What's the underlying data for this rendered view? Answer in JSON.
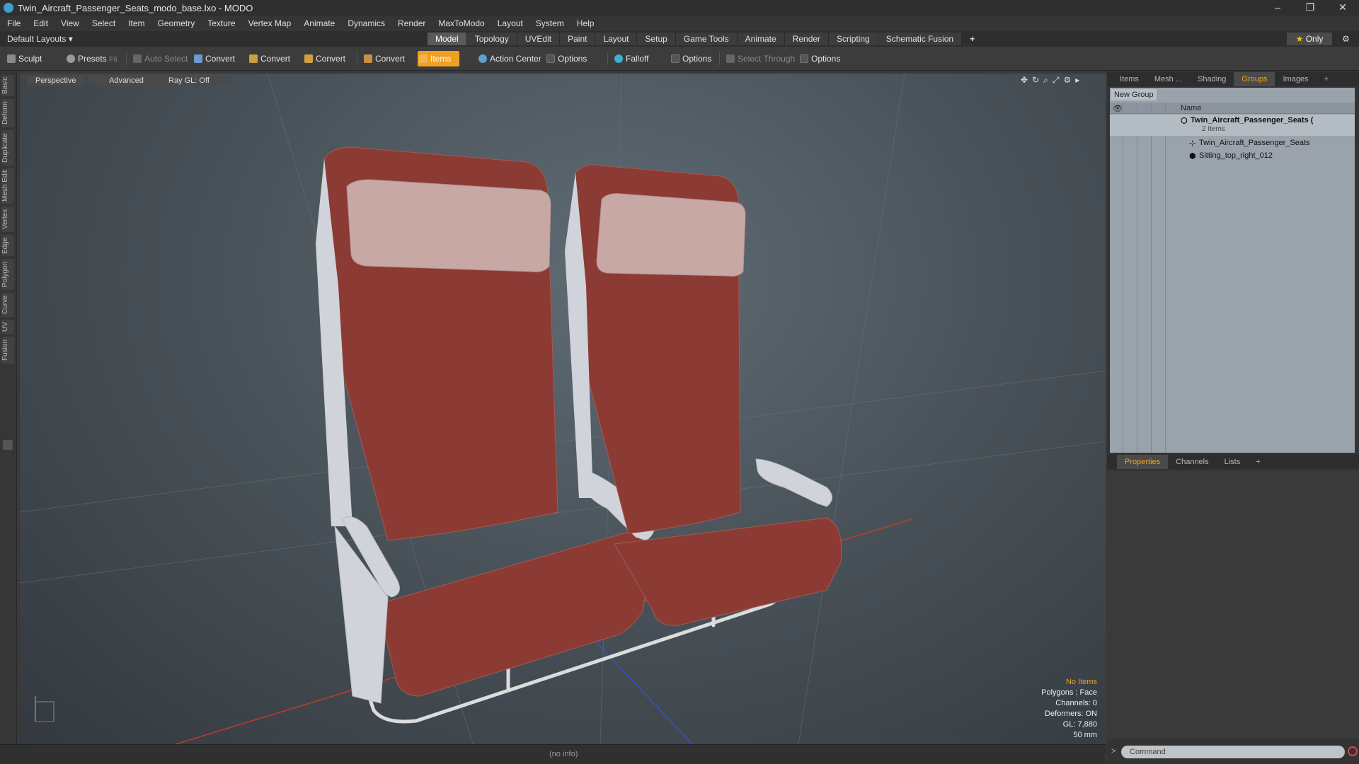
{
  "window": {
    "title": "Twin_Aircraft_Passenger_Seats_modo_base.lxo - MODO",
    "controls": [
      "–",
      "❐",
      "✕"
    ]
  },
  "menu": [
    "File",
    "Edit",
    "View",
    "Select",
    "Item",
    "Geometry",
    "Texture",
    "Vertex Map",
    "Animate",
    "Dynamics",
    "Render",
    "MaxToModo",
    "Layout",
    "System",
    "Help"
  ],
  "layoutbar": {
    "layouts_label": "Default Layouts ▾",
    "tabs": [
      "Model",
      "Topology",
      "UVEdit",
      "Paint",
      "Layout",
      "Setup",
      "Game Tools",
      "Animate",
      "Render",
      "Scripting",
      "Schematic Fusion",
      "+"
    ],
    "active_tab": "Model",
    "only_star": "★",
    "only_label": "Only"
  },
  "toolbar": {
    "sculpt": "Sculpt",
    "presets": "Presets",
    "presets_key": "F6",
    "auto_select": "Auto Select",
    "convert1": "Convert",
    "convert2": "Convert",
    "convert3": "Convert",
    "convert4": "Convert",
    "items": "Items",
    "action_center": "Action Center",
    "options1": "Options",
    "falloff": "Falloff",
    "options2": "Options",
    "select_through": "Select Through",
    "options3": "Options"
  },
  "left_tabs": [
    "Basic",
    "Deform",
    "Duplicate",
    "Mesh Edit",
    "Vertex",
    "Edge",
    "Polygon",
    "Curve",
    "UV",
    "Fusion"
  ],
  "viewport": {
    "view_mode": "Perspective",
    "shading": "Advanced",
    "raygl": "Ray GL: Off",
    "info": {
      "selection": "No Items",
      "polygons": "Polygons : Face",
      "channels": "Channels: 0",
      "deformers": "Deformers: ON",
      "gl": "GL: 7,880",
      "focal": "50 mm"
    },
    "colors": {
      "seat": "#8c3a34",
      "headrest": "#c8a8a4",
      "frame": "#d0d4da",
      "accent": "#f0a020"
    }
  },
  "status": {
    "info": "(no info)"
  },
  "panel_top": {
    "tabs": [
      "Items",
      "Mesh ...",
      "Shading",
      "Groups",
      "Images",
      "+"
    ],
    "active_tab": "Groups",
    "new_group": "New Group",
    "column_name": "Name",
    "tree": [
      {
        "name": "Twin_Aircraft_Passenger_Seats (",
        "sub": "2 Items",
        "icon": "group-icon"
      },
      {
        "name": "Twin_Aircraft_Passenger_Seats",
        "icon": "locator-icon"
      },
      {
        "name": "Sitting_top_right_012",
        "icon": "mesh-icon"
      }
    ]
  },
  "panel_bottom": {
    "tabs": [
      "Properties",
      "Channels",
      "Lists",
      "+"
    ],
    "active_tab": "Properties"
  },
  "command": {
    "placeholder": "Command",
    "prompt": ">"
  }
}
